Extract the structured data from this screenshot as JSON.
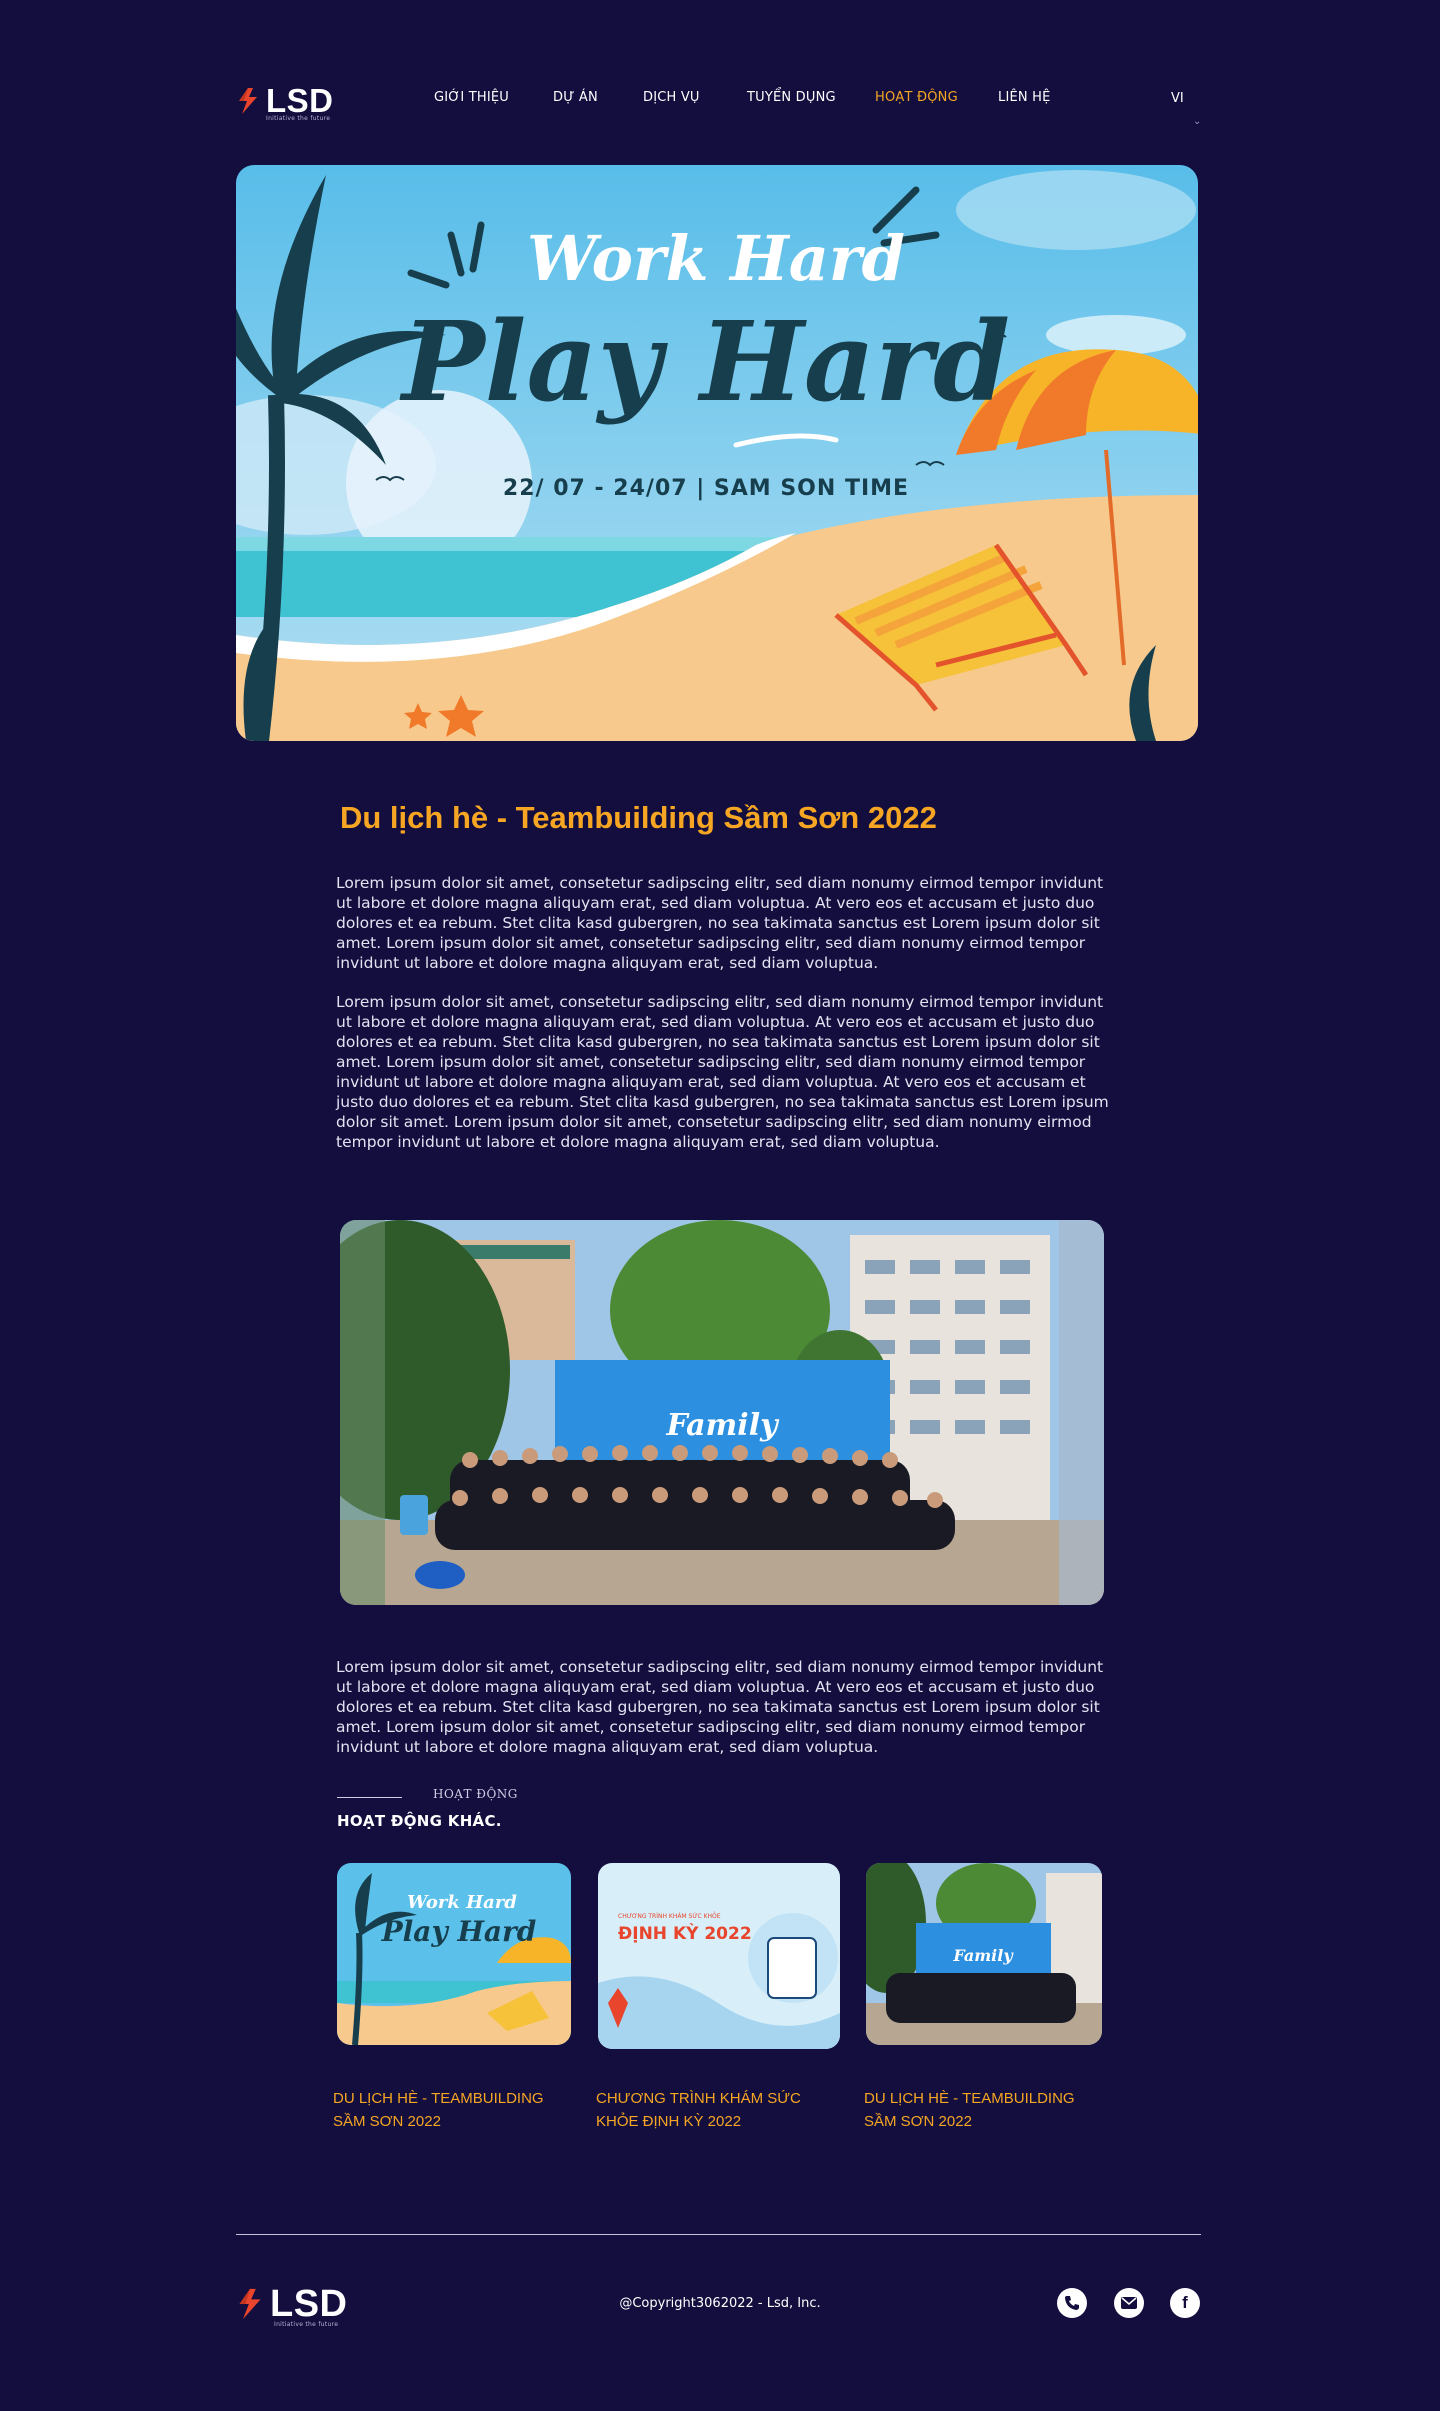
{
  "brand": {
    "name": "LSD",
    "tagline": "Initiative the future"
  },
  "nav": {
    "items": [
      {
        "label": "GIỚI THIỆU",
        "active": false
      },
      {
        "label": "DỰ ÁN",
        "active": false
      },
      {
        "label": "DỊCH VỤ",
        "active": false
      },
      {
        "label": "TUYỂN DỤNG",
        "active": false
      },
      {
        "label": "HOẠT ĐỘNG",
        "active": true
      },
      {
        "label": "LIÊN HỆ",
        "active": false
      }
    ],
    "language": "VI"
  },
  "hero": {
    "title_small": "Work Hard",
    "title_big": "Play Hard",
    "date_line": "22/ 07 - 24/07 | SAM SON TIME"
  },
  "article": {
    "title": "Du lịch hè - Teambuilding Sầm Sơn 2022",
    "paragraphs": [
      "Lorem ipsum dolor sit amet, consetetur sadipscing elitr, sed diam nonumy eirmod tempor invidunt ut labore et dolore magna aliquyam erat, sed diam voluptua. At vero eos et accusam et justo duo dolores et ea rebum. Stet clita kasd gubergren, no sea takimata sanctus est Lorem ipsum dolor sit amet. Lorem ipsum dolor sit amet, consetetur sadipscing elitr, sed diam nonumy eirmod tempor invidunt ut labore et dolore magna aliquyam erat, sed diam voluptua.",
      "Lorem ipsum dolor sit amet, consetetur sadipscing elitr, sed diam nonumy eirmod tempor invidunt ut labore et dolore magna aliquyam erat, sed diam voluptua. At vero eos et accusam et justo duo dolores et ea rebum. Stet clita kasd gubergren, no sea takimata sanctus est Lorem ipsum dolor sit amet. Lorem ipsum dolor sit amet, consetetur sadipscing elitr, sed diam nonumy eirmod tempor invidunt ut labore et dolore magna aliquyam erat, sed diam voluptua.  At vero eos et accusam et justo duo dolores et ea rebum. Stet clita kasd gubergren, no sea takimata sanctus est Lorem ipsum dolor sit amet. Lorem ipsum dolor sit amet, consetetur sadipscing elitr, sed diam nonumy eirmod tempor invidunt ut labore et dolore magna aliquyam erat, sed diam voluptua.",
      "Lorem ipsum dolor sit amet, consetetur sadipscing elitr, sed diam nonumy eirmod tempor invidunt ut labore et dolore magna aliquyam erat, sed diam voluptua. At vero eos et accusam et justo duo dolores et ea rebum. Stet clita kasd gubergren, no sea takimata sanctus est Lorem ipsum dolor sit amet. Lorem ipsum dolor sit amet, consetetur sadipscing elitr, sed diam nonumy eirmod tempor invidunt ut labore et dolore magna aliquyam erat, sed diam voluptua."
    ],
    "photo_banner_text": "Family"
  },
  "other_activities": {
    "kicker": "HOẠT ĐỘNG",
    "title": "HOẠT ĐỘNG KHÁC.",
    "cards": [
      {
        "title": "DU LỊCH HÈ - TEAMBUILDING SẦM SƠN 2022",
        "thumb_text_1": "Work Hard",
        "thumb_text_2": "Play Hard"
      },
      {
        "title": "CHƯƠNG TRÌNH KHÁM SỨC KHỎE ĐỊNH KỲ 2022",
        "thumb_text_1": "ĐỊNH KỲ 2022",
        "thumb_text_2": "CHƯƠNG TRÌNH KHÁM SỨC KHỎE"
      },
      {
        "title": "DU LỊCH HÈ - TEAMBUILDING SẦM SƠN 2022",
        "thumb_text_1": "Family",
        "thumb_text_2": ""
      }
    ]
  },
  "footer": {
    "copyright": "@Copyright3062022 - Lsd, Inc.",
    "social": [
      "phone-icon",
      "mail-icon",
      "facebook-icon"
    ]
  },
  "colors": {
    "background": "#130e3e",
    "accent": "#f6a623",
    "text": "#ffffff"
  }
}
